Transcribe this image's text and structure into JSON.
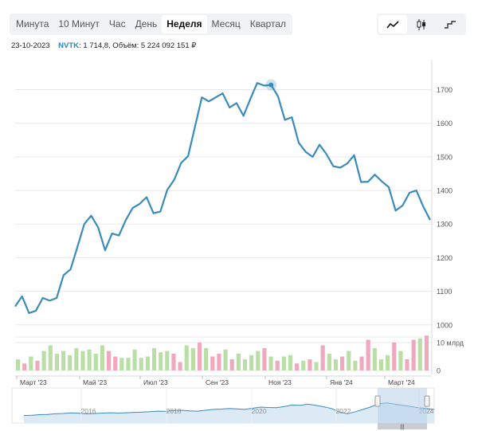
{
  "tabs": [
    {
      "label": "Минута",
      "active": false
    },
    {
      "label": "10 Минут",
      "active": false
    },
    {
      "label": "Час",
      "active": false
    },
    {
      "label": "День",
      "active": false
    },
    {
      "label": "Неделя",
      "active": true
    },
    {
      "label": "Месяц",
      "active": false
    },
    {
      "label": "Квартал",
      "active": false
    }
  ],
  "chart_types": [
    {
      "icon": "line-chart-icon",
      "active": true
    },
    {
      "icon": "candlestick-icon",
      "active": false
    },
    {
      "icon": "step-chart-icon",
      "active": false
    }
  ],
  "info": {
    "date": "23-10-2023",
    "ticker": "NVTK",
    "details": ": 1 714,8, Объём: 5 224 092 151 ₽"
  },
  "colors": {
    "line": "#3a8bbb",
    "vol_up": "#b9dfa6",
    "vol_down": "#efa8bd",
    "navigator_fill": "#dceaf6",
    "navigator_window": "#b8d0ea"
  },
  "chart_data": {
    "type": "line",
    "series": [
      {
        "values": [
          1055,
          1085,
          1035,
          1042,
          1080,
          1072,
          1080,
          1148,
          1165,
          1232,
          1300,
          1325,
          1290,
          1222,
          1272,
          1266,
          1312,
          1348,
          1360,
          1380,
          1332,
          1337,
          1402,
          1432,
          1482,
          1502,
          1590,
          1677,
          1665,
          1677,
          1689,
          1647,
          1660,
          1622,
          1672,
          1720,
          1712,
          1714,
          1680,
          1610,
          1618,
          1542,
          1515,
          1500,
          1536,
          1508,
          1472,
          1468,
          1480,
          1505,
          1425,
          1426,
          1447,
          1427,
          1410,
          1340,
          1355,
          1393,
          1400,
          1352,
          1312
        ]
      }
    ],
    "highlight_index": 37,
    "ylim": [
      990,
      1770
    ],
    "yticks": [
      1000,
      1100,
      1200,
      1300,
      1400,
      1500,
      1600,
      1700
    ],
    "x_tick_labels": [
      "Март '23",
      "Май '23",
      "Июл '23",
      "Сен '23",
      "Ноя '23",
      "Янв '24",
      "Март '24"
    ],
    "volume": {
      "label_top": "10 млрд",
      "label_zero": "0",
      "max": 12,
      "values": [
        4,
        2.5,
        5,
        3.5,
        7,
        9,
        6,
        7,
        5.5,
        8,
        7,
        7.5,
        6,
        9,
        7,
        5,
        4.5,
        4.5,
        7.5,
        4.5,
        5,
        8,
        6.5,
        7,
        6,
        3,
        9,
        8,
        10,
        8,
        5,
        6,
        7.5,
        4,
        6,
        4,
        5.5,
        7,
        8,
        5,
        3.5,
        5,
        5.5,
        2.5,
        3.5,
        4,
        3,
        9,
        6,
        4,
        5,
        7,
        3.5,
        5,
        11,
        8,
        4,
        5.5,
        10,
        7,
        4,
        11,
        11.5,
        12.5
      ],
      "up": [
        true,
        false,
        true,
        false,
        true,
        true,
        true,
        true,
        true,
        true,
        true,
        true,
        true,
        true,
        false,
        false,
        true,
        true,
        true,
        true,
        true,
        true,
        true,
        true,
        false,
        false,
        true,
        true,
        false,
        true,
        false,
        false,
        true,
        false,
        true,
        true,
        true,
        true,
        false,
        true,
        false,
        true,
        true,
        false,
        true,
        false,
        true,
        false,
        true,
        true,
        false,
        true,
        true,
        false,
        false,
        true,
        true,
        true,
        false,
        true,
        false,
        false,
        true,
        false
      ]
    },
    "navigator": {
      "years": [
        "2016",
        "2018",
        "2020",
        "2022",
        "2024"
      ],
      "values": [
        0.2,
        0.22,
        0.25,
        0.26,
        0.3,
        0.32,
        0.35,
        0.33,
        0.3,
        0.32,
        0.34,
        0.36,
        0.34,
        0.36,
        0.38,
        0.4,
        0.42,
        0.45,
        0.44,
        0.48,
        0.5,
        0.47,
        0.45,
        0.5,
        0.55,
        0.57,
        0.6,
        0.58,
        0.55,
        0.62,
        0.68,
        0.66,
        0.65,
        0.72,
        0.8,
        0.78,
        0.85,
        0.78,
        0.7,
        0.6,
        0.4,
        0.3,
        0.42,
        0.55,
        0.7,
        0.88,
        0.92,
        0.85,
        0.78,
        0.72,
        0.65,
        0.6,
        0.55
      ]
    }
  }
}
